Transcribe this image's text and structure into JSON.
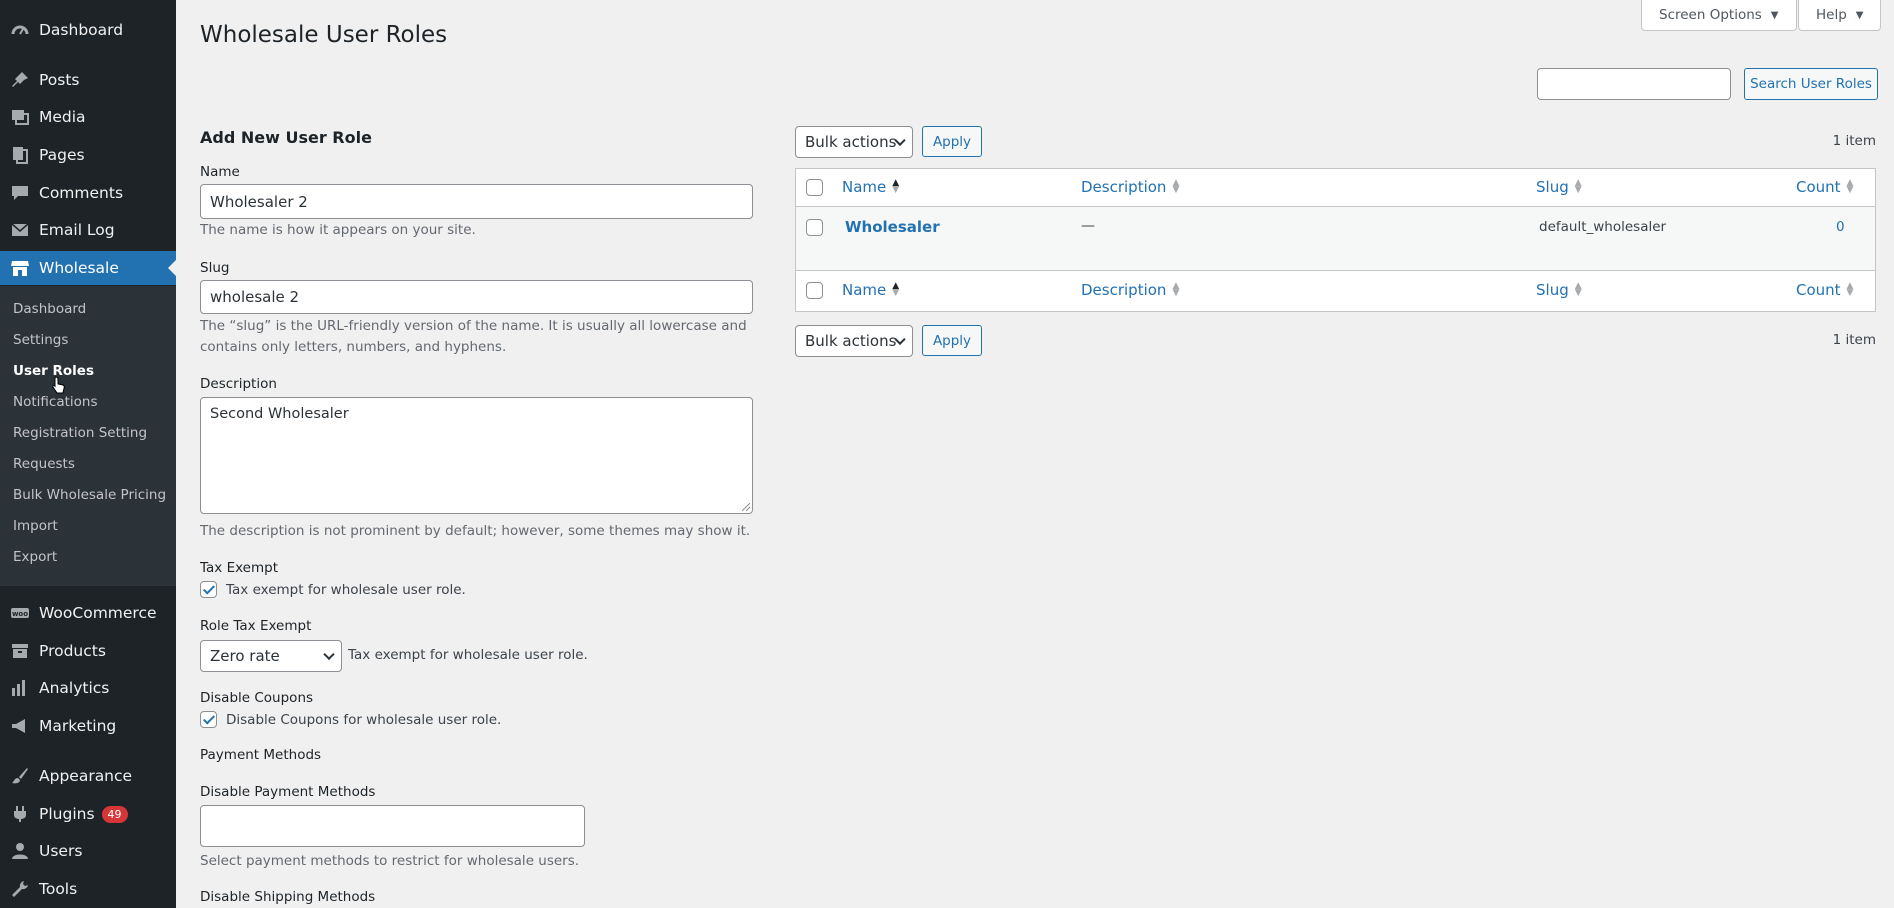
{
  "sidebar": {
    "items": [
      {
        "label": "Dashboard",
        "icon": "dashboard-icon"
      },
      {
        "label": "Posts",
        "icon": "pin-icon"
      },
      {
        "label": "Media",
        "icon": "media-icon"
      },
      {
        "label": "Pages",
        "icon": "pages-icon"
      },
      {
        "label": "Comments",
        "icon": "comment-icon"
      },
      {
        "label": "Email Log",
        "icon": "email-icon"
      },
      {
        "label": "Wholesale",
        "icon": "store-icon"
      },
      {
        "label": "WooCommerce",
        "icon": "woo-icon"
      },
      {
        "label": "Products",
        "icon": "archive-icon"
      },
      {
        "label": "Analytics",
        "icon": "chart-bar-icon"
      },
      {
        "label": "Marketing",
        "icon": "megaphone-icon"
      },
      {
        "label": "Appearance",
        "icon": "brush-icon"
      },
      {
        "label": "Plugins",
        "icon": "plugin-icon",
        "badge": "49"
      },
      {
        "label": "Users",
        "icon": "user-icon"
      },
      {
        "label": "Tools",
        "icon": "wrench-icon"
      }
    ],
    "submenu": [
      "Dashboard",
      "Settings",
      "User Roles",
      "Notifications",
      "Registration Setting",
      "Requests",
      "Bulk Wholesale Pricing",
      "Import",
      "Export"
    ],
    "accent_color": "#2271b1"
  },
  "header": {
    "title": "Wholesale User Roles",
    "screen_options": "Screen Options",
    "help": "Help"
  },
  "search": {
    "value": "",
    "button": "Search User Roles"
  },
  "form": {
    "heading": "Add New User Role",
    "name_label": "Name",
    "name_value": "Wholesaler 2",
    "name_hint": "The name is how it appears on your site.",
    "slug_label": "Slug",
    "slug_value": "wholesale 2",
    "slug_hint_1": "The “slug” is the URL-friendly version of the name. It is usually all lowercase and",
    "slug_hint_2": "contains only letters, numbers, and hyphens.",
    "desc_label": "Description",
    "desc_value": "Second Wholesaler",
    "desc_hint": "The description is not prominent by default; however, some themes may show it.",
    "tax_exempt_label": "Tax Exempt",
    "tax_exempt_cb": "Tax exempt for wholesale user role.",
    "role_tax_label": "Role Tax Exempt",
    "role_tax_value": "Zero rate",
    "role_tax_hint": "Tax exempt for wholesale user role.",
    "disable_coupons_label": "Disable Coupons",
    "disable_coupons_cb": "Disable Coupons for wholesale user role.",
    "payment_methods_label": "Payment Methods",
    "disable_payment_label": "Disable Payment Methods",
    "disable_payment_hint": "Select payment methods to restrict for wholesale users.",
    "disable_shipping_label": "Disable Shipping Methods"
  },
  "table": {
    "bulk_actions": "Bulk actions",
    "apply": "Apply",
    "items_count": "1 item",
    "columns": [
      "Name",
      "Description",
      "Slug",
      "Count"
    ],
    "rows": [
      {
        "name": "Wholesaler",
        "description": "—",
        "slug": "default_wholesaler",
        "count": "0"
      }
    ]
  }
}
